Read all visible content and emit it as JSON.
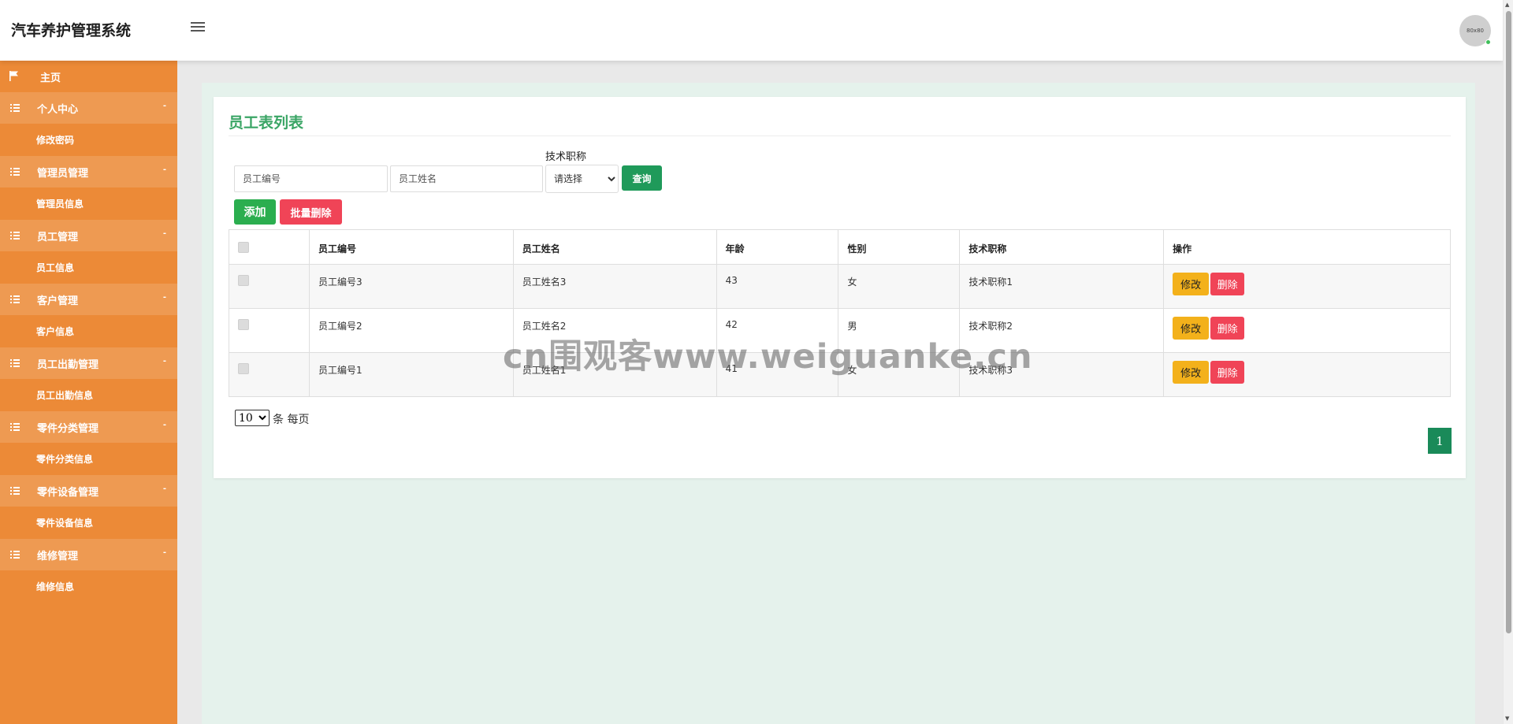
{
  "app": {
    "title": "汽车养护管理系统",
    "avatar_text": "80x80"
  },
  "sidebar": {
    "home": "主页",
    "groups": [
      {
        "label": "个人中心",
        "caret": "-",
        "items": [
          "修改密码"
        ]
      },
      {
        "label": "管理员管理",
        "caret": "-",
        "items": [
          "管理员信息"
        ]
      },
      {
        "label": "员工管理",
        "caret": "-",
        "items": [
          "员工信息"
        ]
      },
      {
        "label": "客户管理",
        "caret": "-",
        "items": [
          "客户信息"
        ]
      },
      {
        "label": "员工出勤管理",
        "caret": "-",
        "items": [
          "员工出勤信息"
        ]
      },
      {
        "label": "零件分类管理",
        "caret": "-",
        "items": [
          "零件分类信息"
        ]
      },
      {
        "label": "零件设备管理",
        "caret": "-",
        "items": [
          "零件设备信息"
        ]
      },
      {
        "label": "维修管理",
        "caret": "-",
        "items": [
          "维修信息"
        ]
      }
    ]
  },
  "page": {
    "title": "员工表列表",
    "filters": {
      "emp_no_placeholder": "员工编号",
      "emp_name_placeholder": "员工姓名",
      "title_label": "技术职称",
      "title_select": "请选择",
      "query_label": "查询"
    },
    "actions": {
      "add": "添加",
      "bulk_delete": "批量删除"
    },
    "table": {
      "headers": [
        "员工编号",
        "员工姓名",
        "年龄",
        "性别",
        "技术职称",
        "操作"
      ],
      "rows": [
        {
          "emp_no": "员工编号3",
          "emp_name": "员工姓名3",
          "age": "43",
          "gender": "女",
          "tech_title": "技术职称1"
        },
        {
          "emp_no": "员工编号2",
          "emp_name": "员工姓名2",
          "age": "42",
          "gender": "男",
          "tech_title": "技术职称2"
        },
        {
          "emp_no": "员工编号1",
          "emp_name": "员工姓名1",
          "age": "41",
          "gender": "女",
          "tech_title": "技术职称3"
        }
      ],
      "edit_label": "修改",
      "delete_label": "删除"
    },
    "pagination": {
      "page_size": "10",
      "per_page_text": "条 每页",
      "current_page": "1"
    }
  },
  "watermark": "cn围观客www.weiguanke.cn"
}
